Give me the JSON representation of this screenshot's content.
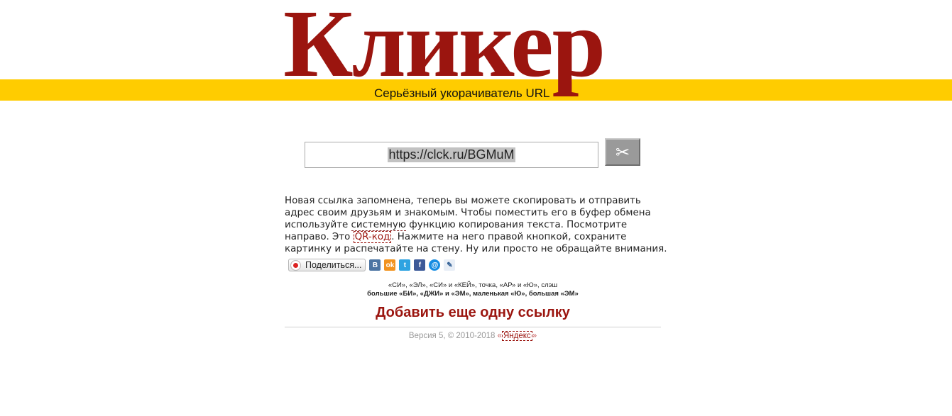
{
  "header": {
    "logo": "Кликер",
    "tagline": "Серьёзный укорачиватель URL"
  },
  "url_field": {
    "value": "https://clck.ru/BGMuM"
  },
  "cut_button": {
    "icon": "scissors-icon",
    "glyph": "✂"
  },
  "message": {
    "part1": "Новая ссылка запомнена, теперь вы можете скопировать и отправить адрес своим друзьям и знакомым. Чтобы поместить его в буфер обмена используйте ",
    "system_word": "системную",
    "part2": " функцию копирования текста. Посмотрите направо. Это ",
    "qr_link": "QR-код",
    "part3": ". Нажмите на него правой кнопкой, сохраните картинку и распечатайте на стену. Ну или просто не обращайте внимания."
  },
  "share": {
    "button_label": "Поделиться...",
    "networks": [
      {
        "name": "vkontakte-icon",
        "glyph": "В"
      },
      {
        "name": "odnoklassniki-icon",
        "glyph": "ok"
      },
      {
        "name": "twitter-icon",
        "glyph": "t"
      },
      {
        "name": "facebook-icon",
        "glyph": "f"
      },
      {
        "name": "moimir-icon",
        "glyph": "@"
      },
      {
        "name": "livejournal-icon",
        "glyph": "✎"
      }
    ]
  },
  "spelling": {
    "line1": "«СИ», «ЭЛ», «СИ» и «КЕЙ», точка, «АР» и «Ю», слэш",
    "line2": "большие «БИ», «ДЖИ» и «ЭМ», маленькая «Ю», большая «ЭМ»"
  },
  "add_link": "Добавить еще одну ссылку",
  "footer": {
    "text": "Версия 5, © 2010-2018 ",
    "open_quote": "«",
    "yandex": "Яндекс",
    "close_quote": "»"
  },
  "colors": {
    "brand_red": "#9b150f",
    "band_yellow": "#ffcc00"
  }
}
